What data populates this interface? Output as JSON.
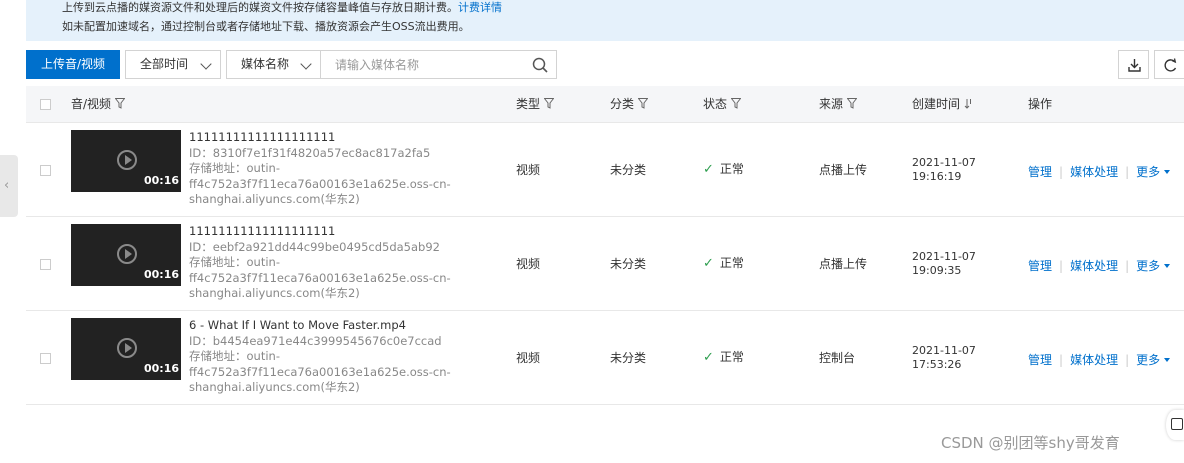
{
  "notice": {
    "line1_text": "上传到云点播的媒资源文件和处理后的媒资文件按存储容量峰值与存放日期计费。",
    "line1_link": "计费详情",
    "line2_text": "如未配置加速域名，通过控制台或者存储地址下载、播放资源会产生OSS流出费用。"
  },
  "toolbar": {
    "upload_label": "上传音/视频",
    "time_select": "全部时间",
    "media_select": "媒体名称",
    "search_placeholder": "请输入媒体名称"
  },
  "table": {
    "headers": {
      "media": "音/视频",
      "type": "类型",
      "category": "分类",
      "status": "状态",
      "source": "来源",
      "created": "创建时间",
      "actions": "操作"
    },
    "rows": [
      {
        "duration": "00:16",
        "title": "11111111111111111111",
        "id": "ID：8310f7e1f31f4820a57ec8ac817a2fa5",
        "storage_label": "存储地址：outin-",
        "storage_line2": "ff4c752a3f7f11eca76a00163e1a625e.oss-cn-",
        "storage_line3": "shanghai.aliyuncs.com(华东2)",
        "type": "视频",
        "category": "未分类",
        "status": "正常",
        "source": "点播上传",
        "date": "2021-11-07",
        "time": "19:16:19"
      },
      {
        "duration": "00:16",
        "title": "11111111111111111111",
        "id": "ID：eebf2a921dd44c99be0495cd5da5ab92",
        "storage_label": "存储地址：outin-",
        "storage_line2": "ff4c752a3f7f11eca76a00163e1a625e.oss-cn-",
        "storage_line3": "shanghai.aliyuncs.com(华东2)",
        "type": "视频",
        "category": "未分类",
        "status": "正常",
        "source": "点播上传",
        "date": "2021-11-07",
        "time": "19:09:35"
      },
      {
        "duration": "00:16",
        "title": "6 - What If I Want to Move Faster.mp4",
        "id": "ID：b4454ea971e44c3999545676c0e7ccad",
        "storage_label": "存储地址：outin-",
        "storage_line2": "ff4c752a3f7f11eca76a00163e1a625e.oss-cn-",
        "storage_line3": "shanghai.aliyuncs.com(华东2)",
        "type": "视频",
        "category": "未分类",
        "status": "正常",
        "source": "控制台",
        "date": "2021-11-07",
        "time": "17:53:26"
      }
    ],
    "actions": {
      "manage": "管理",
      "process": "媒体处理",
      "more": "更多"
    }
  },
  "watermark": "CSDN @别团等shy哥发育",
  "colors": {
    "primary": "#0070cc",
    "notice_bg": "#e5f1fb",
    "ok_green": "#2e9e4f"
  }
}
